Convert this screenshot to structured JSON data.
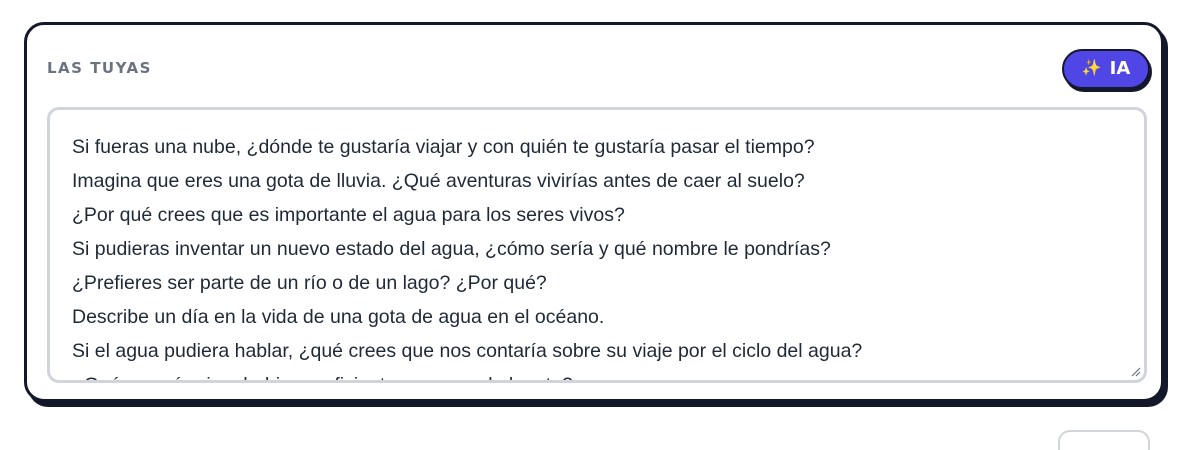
{
  "section": {
    "title": "LAS TUYAS"
  },
  "ai_button": {
    "icon": "sparkles-icon",
    "label": "IA",
    "color": "#4f46e5"
  },
  "textarea": {
    "lines": [
      "Si fueras una nube, ¿dónde te gustaría viajar y con quién te gustaría pasar el tiempo?",
      "Imagina que eres una gota de lluvia. ¿Qué aventuras vivirías antes de caer al suelo?",
      "¿Por qué crees que es importante el agua para los seres vivos?",
      "Si pudieras inventar un nuevo estado del agua, ¿cómo sería y qué nombre le pondrías?",
      "¿Prefieres ser parte de un río o de un lago? ¿Por qué?",
      "Describe un día en la vida de una gota de agua en el océano.",
      "Si el agua pudiera hablar, ¿qué crees que nos contaría sobre su viaje por el ciclo del agua?",
      "¿Qué pasaría si no hubiera suficiente agua en el planeta?"
    ]
  }
}
